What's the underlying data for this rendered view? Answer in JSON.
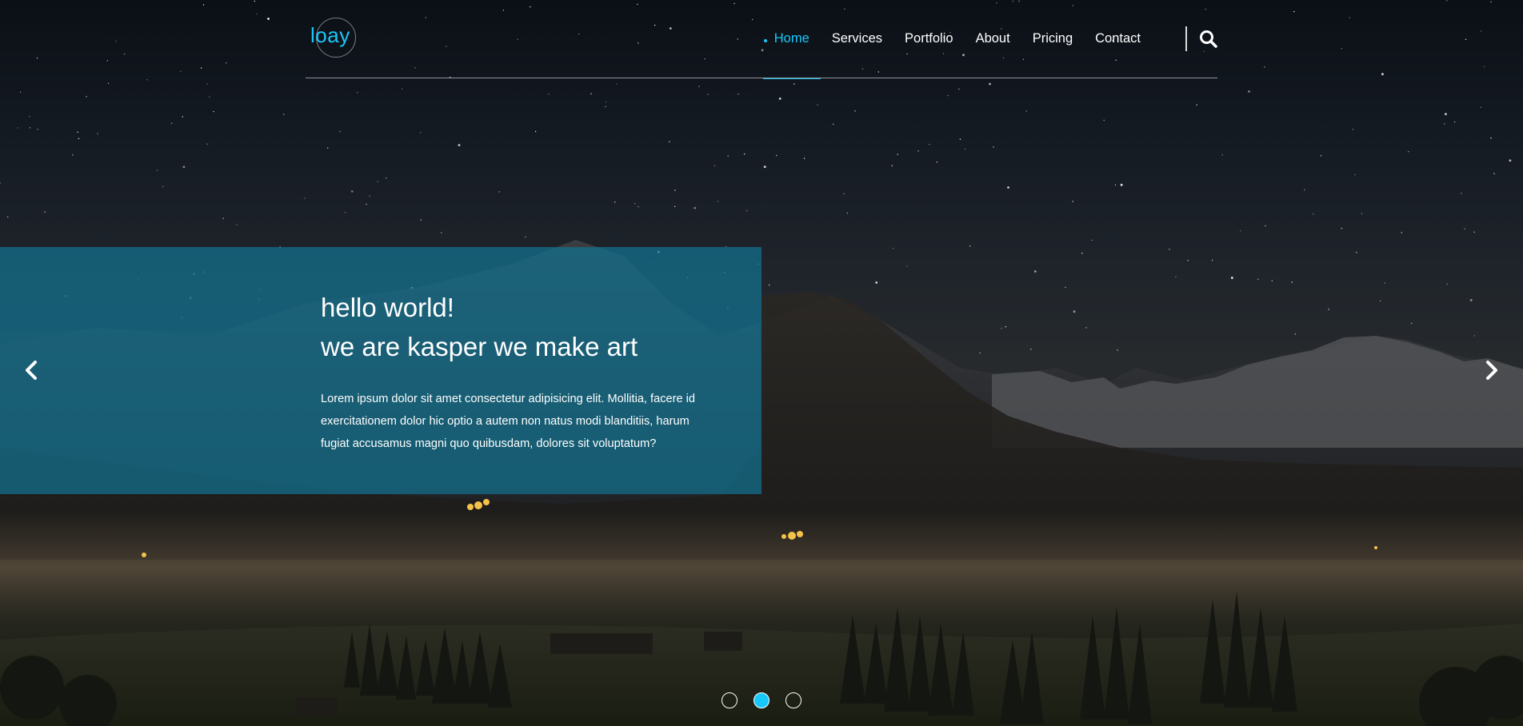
{
  "logo": {
    "text": "loay"
  },
  "nav": {
    "items": [
      {
        "label": "Home",
        "active": true
      },
      {
        "label": "Services",
        "active": false
      },
      {
        "label": "Portfolio",
        "active": false
      },
      {
        "label": "About",
        "active": false
      },
      {
        "label": "Pricing",
        "active": false
      },
      {
        "label": "Contact",
        "active": false
      }
    ],
    "search_icon": "search-icon"
  },
  "hero": {
    "headline_line1": "hello world!",
    "headline_line2": "we are kasper we make art",
    "body": "Lorem ipsum dolor sit amet consectetur adipisicing elit. Mollitia, facere id exercitationem dolor hic optio a autem non natus modi blanditiis, harum fugiat accusamus magni quo quibusdam, dolores sit voluptatum?",
    "prev_icon": "chevron-left-icon",
    "next_icon": "chevron-right-icon"
  },
  "slider": {
    "bullets": [
      {
        "active": false
      },
      {
        "active": true
      },
      {
        "active": false
      }
    ]
  },
  "colors": {
    "accent": "#19c8fa",
    "overlay": "#136f8c"
  }
}
